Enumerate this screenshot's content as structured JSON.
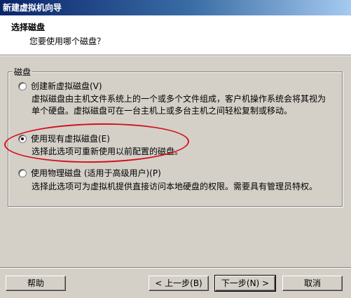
{
  "window": {
    "title": "新建虚拟机向导"
  },
  "header": {
    "title": "选择磁盘",
    "subtitle": "您要使用哪个磁盘？"
  },
  "group": {
    "legend": "磁盘",
    "options": [
      {
        "label": "创建新虚拟磁盘(V)",
        "desc_line1": "虚拟磁盘由主机文件系统上的一个或多个文件组成，客户机操作系统会将其视为",
        "desc_line2": "单个硬盘。虚拟磁盘可在一台主机上或多台主机之间轻松复制或移动。",
        "selected": false
      },
      {
        "label": "使用现有虚拟磁盘(E)",
        "desc_line1": "选择此选项可重新使用以前配置的磁盘。",
        "selected": true
      },
      {
        "label": "使用物理磁盘 (适用于高级用户)(P)",
        "desc_line1": "选择此选项可为虚拟机提供直接访问本地硬盘的权限。需要具有管理员特权。",
        "selected": false
      }
    ]
  },
  "buttons": {
    "help": "帮助",
    "back": "< 上一步(B)",
    "next": "下一步(N) >",
    "cancel": "取消"
  },
  "colors": {
    "highlight_ellipse": "#d4101c",
    "titlebar_start": "#0a246a",
    "dialog_bg": "#d4d0c8"
  }
}
